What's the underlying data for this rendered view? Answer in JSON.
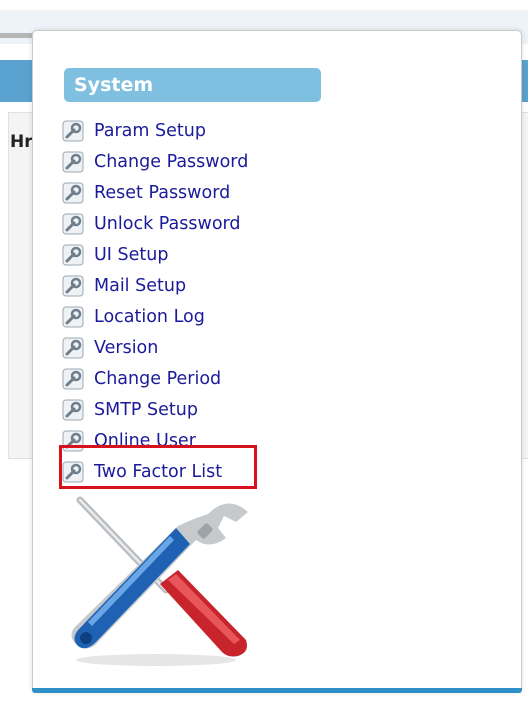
{
  "background": {
    "title_fragment": "Hris"
  },
  "popup": {
    "section_title": "System",
    "menu_items": [
      {
        "label": "Param Setup",
        "icon": "wrench-icon"
      },
      {
        "label": "Change Password",
        "icon": "wrench-icon"
      },
      {
        "label": "Reset Password",
        "icon": "wrench-icon"
      },
      {
        "label": "Unlock Password",
        "icon": "wrench-icon"
      },
      {
        "label": "UI Setup",
        "icon": "wrench-icon"
      },
      {
        "label": "Mail Setup",
        "icon": "wrench-icon"
      },
      {
        "label": "Location Log",
        "icon": "wrench-icon"
      },
      {
        "label": "Version",
        "icon": "wrench-icon"
      },
      {
        "label": "Change Period",
        "icon": "wrench-icon"
      },
      {
        "label": "SMTP Setup",
        "icon": "wrench-icon"
      },
      {
        "label": "Online User",
        "icon": "wrench-icon"
      },
      {
        "label": "Two Factor List",
        "icon": "wrench-icon"
      }
    ],
    "highlighted_item": "Two Factor List",
    "illustration": "screwdriver-wrench-icon"
  },
  "colors": {
    "header_bg": "#7fbfe0",
    "link": "#1a1a9a",
    "highlight_border": "#d6131c",
    "accent_bar": "#2f8fc7"
  }
}
